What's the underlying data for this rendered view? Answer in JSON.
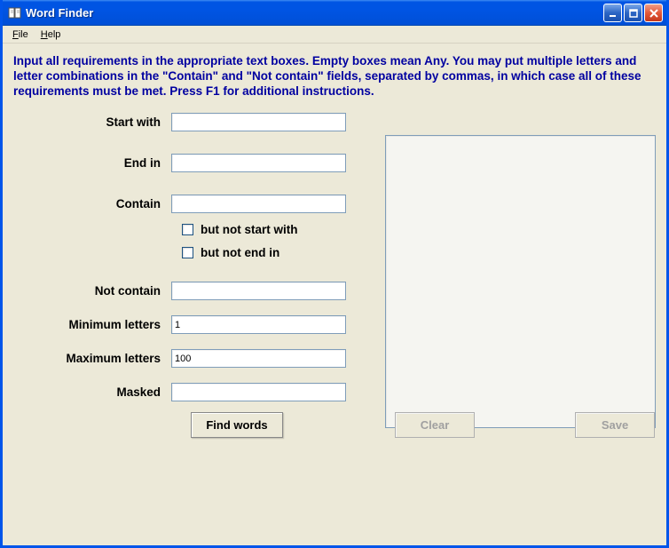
{
  "window": {
    "title": "Word Finder"
  },
  "menu": {
    "file": "File",
    "help": "Help"
  },
  "instructions": "Input all requirements in the appropriate text boxes. Empty boxes mean Any. You may put multiple letters and letter combinations in the \"Contain\" and \"Not contain\" fields, separated by commas, in which case all of these requirements must be met. Press F1 for additional instructions.",
  "labels": {
    "start_with": "Start with",
    "end_in": "End in",
    "contain": "Contain",
    "but_not_start_with": "but not start with",
    "but_not_end_in": "but not end in",
    "not_contain": "Not contain",
    "minimum_letters": "Minimum letters",
    "maximum_letters": "Maximum letters",
    "masked": "Masked"
  },
  "values": {
    "start_with": "",
    "end_in": "",
    "contain": "",
    "but_not_start_with_checked": false,
    "but_not_end_in_checked": false,
    "not_contain": "",
    "minimum_letters": "1",
    "maximum_letters": "100",
    "masked": ""
  },
  "buttons": {
    "find_words": "Find words",
    "clear": "Clear",
    "save": "Save"
  }
}
